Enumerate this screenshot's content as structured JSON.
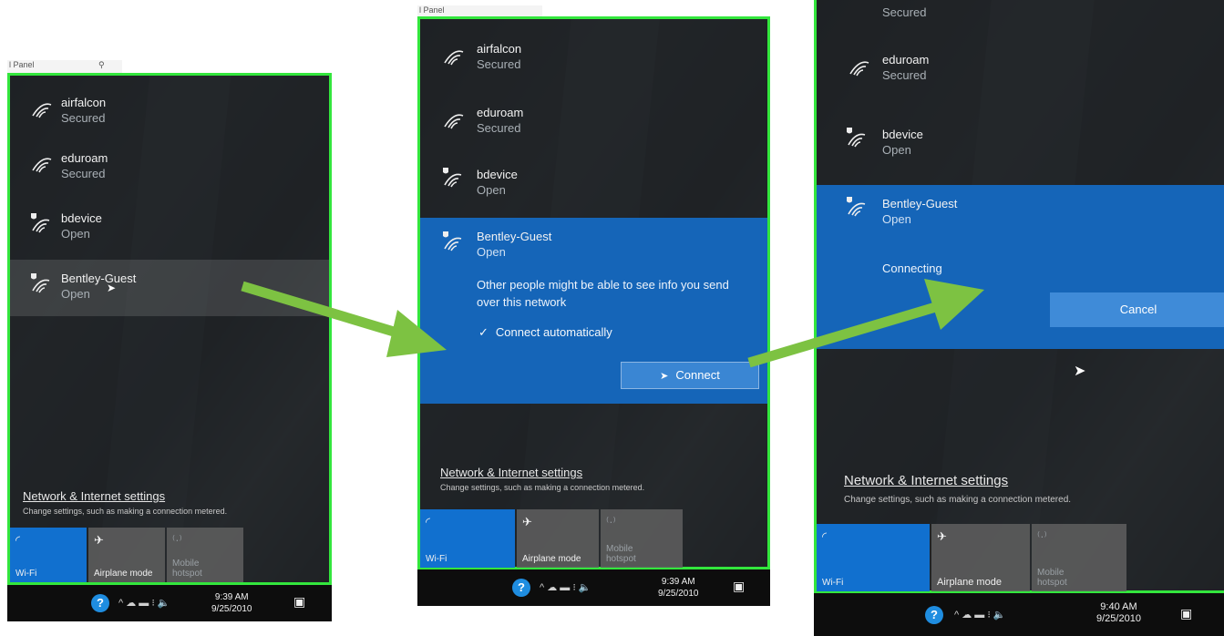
{
  "colors": {
    "highlight_border": "#33e63d",
    "accent_blue": "#1565b8",
    "arrow_green": "#7dc242",
    "tile_active": "#1170cf"
  },
  "background_text": {
    "search_hint": "l Panel",
    "search_hint_2": "l Panel"
  },
  "panel1": {
    "networks": [
      {
        "ssid": "airfalcon",
        "status": "Secured",
        "icon": "wifi-icon"
      },
      {
        "ssid": "eduroam",
        "status": "Secured",
        "icon": "wifi-icon"
      },
      {
        "ssid": "bdevice",
        "status": "Open",
        "icon": "wifi-shield-icon"
      },
      {
        "ssid": "Bentley-Guest",
        "status": "Open",
        "icon": "wifi-shield-icon"
      }
    ],
    "settings_link": "Network & Internet settings",
    "settings_sub": "Change settings, such as making a connection metered.",
    "tiles": [
      {
        "label": "Wi-Fi",
        "icon": "wifi-icon"
      },
      {
        "label": "Airplane mode",
        "icon": "airplane-icon"
      },
      {
        "label": "Mobile hotspot",
        "icon": "hotspot-icon"
      }
    ],
    "clock_time": "9:39 AM",
    "clock_date": "9/25/2010"
  },
  "panel2": {
    "networks": [
      {
        "ssid": "airfalcon",
        "status": "Secured",
        "icon": "wifi-icon"
      },
      {
        "ssid": "eduroam",
        "status": "Secured",
        "icon": "wifi-icon"
      },
      {
        "ssid": "bdevice",
        "status": "Open",
        "icon": "wifi-shield-icon"
      },
      {
        "ssid": "Bentley-Guest",
        "status": "Open",
        "icon": "wifi-shield-icon"
      }
    ],
    "warning": "Other people might be able to see info you send over this network",
    "auto_connect": "Connect automatically",
    "connect_button": "Connect",
    "settings_link": "Network & Internet settings",
    "settings_sub": "Change settings, such as making a connection metered.",
    "tiles": [
      {
        "label": "Wi-Fi",
        "icon": "wifi-icon"
      },
      {
        "label": "Airplane mode",
        "icon": "airplane-icon"
      },
      {
        "label": "Mobile hotspot",
        "icon": "hotspot-icon"
      }
    ],
    "clock_time": "9:39 AM",
    "clock_date": "9/25/2010"
  },
  "panel3": {
    "networks": [
      {
        "ssid": "",
        "status": "Secured",
        "icon": "wifi-icon"
      },
      {
        "ssid": "eduroam",
        "status": "Secured",
        "icon": "wifi-icon"
      },
      {
        "ssid": "bdevice",
        "status": "Open",
        "icon": "wifi-shield-icon"
      },
      {
        "ssid": "Bentley-Guest",
        "status": "Open",
        "icon": "wifi-shield-icon"
      }
    ],
    "connecting": "Connecting",
    "cancel_button": "Cancel",
    "settings_link": "Network & Internet settings",
    "settings_sub": "Change settings, such as making a connection metered.",
    "tiles": [
      {
        "label": "Wi-Fi",
        "icon": "wifi-icon"
      },
      {
        "label": "Airplane mode",
        "icon": "airplane-icon"
      },
      {
        "label": "Mobile hotspot",
        "icon": "hotspot-icon"
      }
    ],
    "clock_time": "9:40 AM",
    "clock_date": "9/25/2010"
  }
}
